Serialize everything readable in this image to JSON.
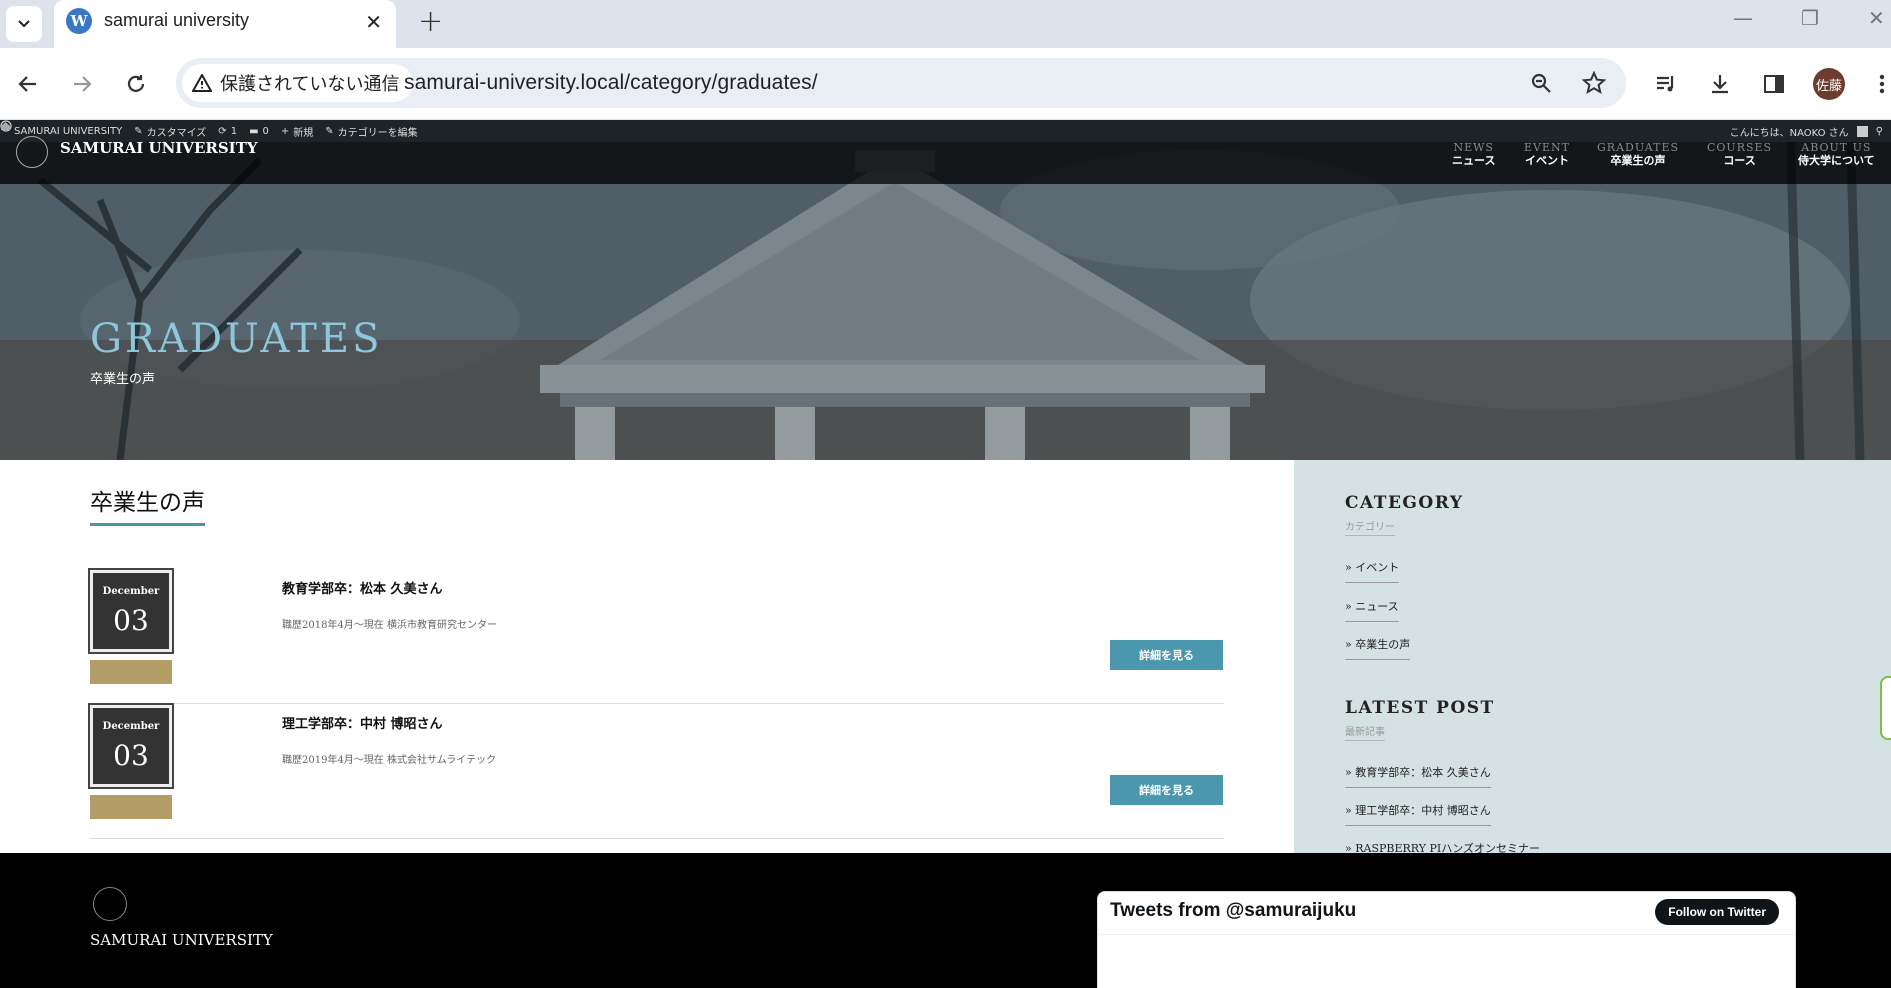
{
  "browser": {
    "tab_title": "samurai university",
    "security_label": "保護されていない通信",
    "url": "samurai-university.local/category/graduates/",
    "profile_label": "佐藤"
  },
  "admin_bar": {
    "site": "SAMURAI UNIVERSITY",
    "customize": "カスタマイズ",
    "updates": "1",
    "comments": "0",
    "new": "新規",
    "edit_category": "カテゴリーを編集",
    "greeting": "こんにちは、NAOKO さん"
  },
  "site": {
    "name": "SAMURAI UNIVERSITY",
    "nav": [
      {
        "en": "NEWS",
        "ja": "ニュース"
      },
      {
        "en": "EVENT",
        "ja": "イベント"
      },
      {
        "en": "GRADUATES",
        "ja": "卒業生の声"
      },
      {
        "en": "COURSES",
        "ja": "コース"
      },
      {
        "en": "ABOUT US",
        "ja": "侍大学について"
      }
    ]
  },
  "hero": {
    "title": "GRADUATES",
    "subtitle": "卒業生の声"
  },
  "main": {
    "heading": "卒業生の声",
    "posts": [
      {
        "month": "December",
        "day": "03",
        "title": "教育学部卒：松本 久美さん",
        "excerpt": "職歴2018年4月〜現在 横浜市教育研究センター",
        "button": "詳細を見る"
      },
      {
        "month": "December",
        "day": "03",
        "title": "理工学部卒：中村 博昭さん",
        "excerpt": "職歴2019年4月〜現在 株式会社サムライテック",
        "button": "詳細を見る"
      }
    ]
  },
  "sidebar": {
    "category_heading": "CATEGORY",
    "category_sub": "カテゴリー",
    "categories": [
      "» イベント",
      "» ニュース",
      "» 卒業生の声"
    ],
    "latest_heading": "LATEST POST",
    "latest_sub": "最新記事",
    "latest": [
      "» 教育学部卒：松本 久美さん",
      "» 理工学部卒：中村 博昭さん",
      "» RASPBERRY PIハンズオンセミナー"
    ]
  },
  "footer": {
    "name": "SAMURAI UNIVERSITY",
    "tweets_title": "Tweets from @samuraijuku",
    "follow_button": "Follow on Twitter"
  }
}
